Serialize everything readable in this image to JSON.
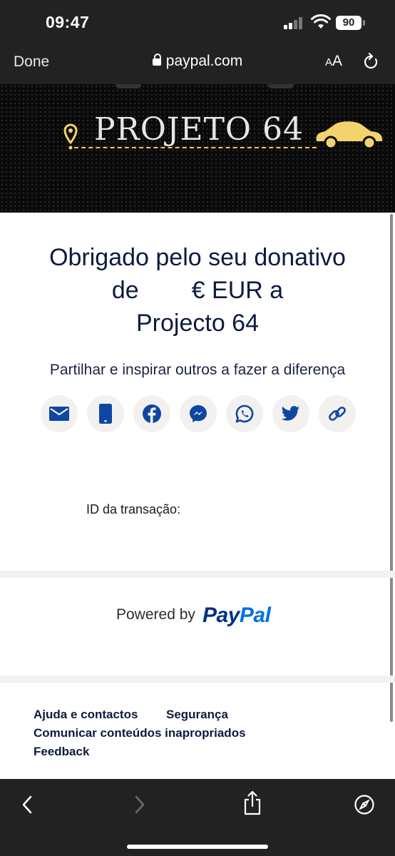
{
  "status_bar": {
    "time": "09:47",
    "battery": "90"
  },
  "browser": {
    "done_label": "Done",
    "url": "paypal.com",
    "text_size_small": "A",
    "text_size_big": "A"
  },
  "banner": {
    "title": "PROJETO 64"
  },
  "main": {
    "heading_line1": "Obrigado pelo seu donativo",
    "heading_line2_prefix": "de",
    "heading_line2_suffix": "€ EUR a",
    "heading_line3": "Projecto 64",
    "share_text": "Partilhar e inspirar outros a fazer a diferença",
    "share_buttons": [
      "email-icon",
      "sms-icon",
      "facebook-icon",
      "messenger-icon",
      "whatsapp-icon",
      "twitter-icon",
      "copy-link-icon"
    ],
    "transaction_label": "ID da transação:"
  },
  "powered": {
    "label": "Powered by",
    "brand_pay": "Pay",
    "brand_pal": "Pal"
  },
  "footer": {
    "help": "Ajuda e contactos",
    "security": "Segurança",
    "report": "Comunicar conteúdos inapropriados",
    "feedback": "Feedback"
  },
  "colors": {
    "brand_dark": "#003087",
    "brand_light": "#0070e0",
    "heading": "#0d1b3e",
    "banner_accent": "#f3d36b"
  }
}
